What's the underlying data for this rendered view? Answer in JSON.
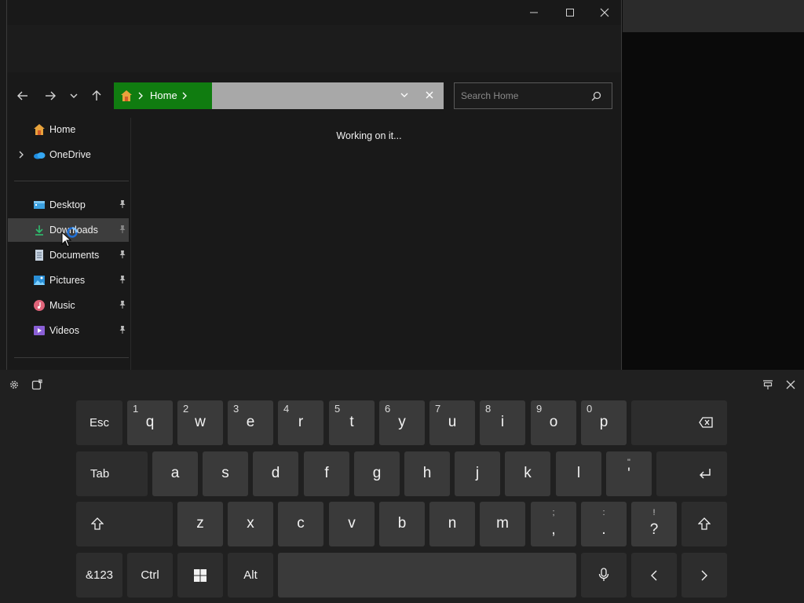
{
  "explorer": {
    "address": {
      "crumb": "Home"
    },
    "search": {
      "placeholder": "Search Home"
    },
    "status": "Working on it...",
    "sidebar": [
      {
        "label": "Home",
        "icon": "home-icon",
        "pinned": false
      },
      {
        "label": "OneDrive",
        "icon": "onedrive-icon",
        "pinned": false
      },
      {
        "label": "Desktop",
        "icon": "desktop-icon",
        "pinned": true
      },
      {
        "label": "Downloads",
        "icon": "downloads-icon",
        "pinned": true,
        "selected": true
      },
      {
        "label": "Documents",
        "icon": "documents-icon",
        "pinned": true
      },
      {
        "label": "Pictures",
        "icon": "pictures-icon",
        "pinned": true
      },
      {
        "label": "Music",
        "icon": "music-icon",
        "pinned": true
      },
      {
        "label": "Videos",
        "icon": "videos-icon",
        "pinned": true
      }
    ],
    "colors": {
      "address_green": "#107c10",
      "window_bg": "#191919"
    }
  },
  "keyboard": {
    "row1": [
      {
        "label": "Esc"
      },
      {
        "label": "q",
        "num": "1"
      },
      {
        "label": "w",
        "num": "2"
      },
      {
        "label": "e",
        "num": "3"
      },
      {
        "label": "r",
        "num": "4"
      },
      {
        "label": "t",
        "num": "5"
      },
      {
        "label": "y",
        "num": "6"
      },
      {
        "label": "u",
        "num": "7"
      },
      {
        "label": "i",
        "num": "8"
      },
      {
        "label": "o",
        "num": "9"
      },
      {
        "label": "p",
        "num": "0"
      }
    ],
    "row2": [
      {
        "label": "Tab"
      },
      {
        "label": "a"
      },
      {
        "label": "s"
      },
      {
        "label": "d"
      },
      {
        "label": "f"
      },
      {
        "label": "g"
      },
      {
        "label": "h"
      },
      {
        "label": "j"
      },
      {
        "label": "k"
      },
      {
        "label": "l"
      },
      {
        "label": "'",
        "sec": "\""
      }
    ],
    "row3": [
      {
        "label": "z"
      },
      {
        "label": "x"
      },
      {
        "label": "c"
      },
      {
        "label": "v"
      },
      {
        "label": "b"
      },
      {
        "label": "n"
      },
      {
        "label": "m"
      },
      {
        "label": ",",
        "sec": ";"
      },
      {
        "label": ".",
        "sec": ":"
      },
      {
        "label": "?",
        "sec": "!"
      }
    ],
    "row4": [
      {
        "label": "&123"
      },
      {
        "label": "Ctrl"
      },
      {
        "label": "Alt"
      }
    ]
  }
}
